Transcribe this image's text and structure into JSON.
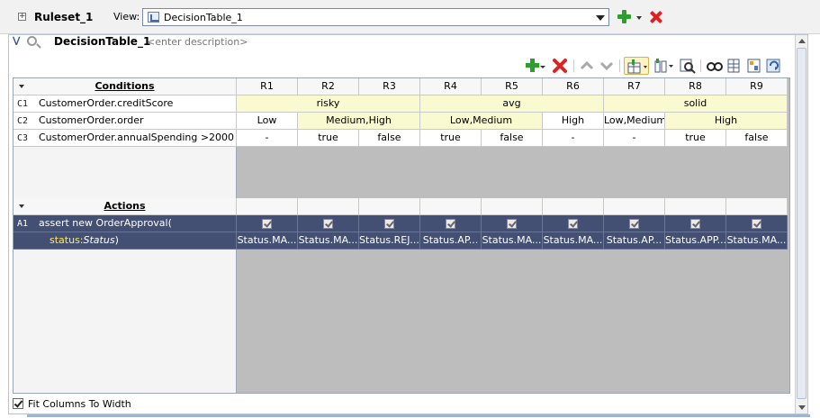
{
  "ruleset": {
    "title": "Ruleset_1",
    "view_label": "View:",
    "view_value": "DecisionTable_1"
  },
  "table": {
    "title": "DecisionTable_1",
    "description": "<enter description>"
  },
  "conditions_header": "Conditions",
  "actions_header": "Actions",
  "columns": [
    "R1",
    "R2",
    "R3",
    "R4",
    "R5",
    "R6",
    "R7",
    "R8",
    "R9"
  ],
  "conditions": [
    {
      "id": "C1",
      "label": "CustomerOrder.creditScore",
      "cells": [
        {
          "text": "risky",
          "span": 3,
          "bg": "#fafad1"
        },
        {
          "text": "avg",
          "span": 3,
          "bg": "#fafad1"
        },
        {
          "text": "solid",
          "span": 3,
          "bg": "#fafad1"
        }
      ]
    },
    {
      "id": "C2",
      "label": "CustomerOrder.order",
      "cells": [
        {
          "text": "Low",
          "span": 1,
          "bg": "#ffffff"
        },
        {
          "text": "Medium,High",
          "span": 2,
          "bg": "#fafad1"
        },
        {
          "text": "Low,Medium",
          "span": 2,
          "bg": "#fafad1"
        },
        {
          "text": "High",
          "span": 1,
          "bg": "#ffffff"
        },
        {
          "text": "Low,Medium",
          "span": 1,
          "bg": "#ffffff"
        },
        {
          "text": "High",
          "span": 2,
          "bg": "#fafad1"
        }
      ]
    },
    {
      "id": "C3",
      "label": "CustomerOrder.annualSpending >2000",
      "cells": [
        {
          "text": "-",
          "span": 1,
          "bg": "#ffffff"
        },
        {
          "text": "true",
          "span": 1,
          "bg": "#ffffff"
        },
        {
          "text": "false",
          "span": 1,
          "bg": "#ffffff"
        },
        {
          "text": "true",
          "span": 1,
          "bg": "#ffffff"
        },
        {
          "text": "false",
          "span": 1,
          "bg": "#ffffff"
        },
        {
          "text": "-",
          "span": 1,
          "bg": "#ffffff"
        },
        {
          "text": "-",
          "span": 1,
          "bg": "#ffffff"
        },
        {
          "text": "true",
          "span": 1,
          "bg": "#ffffff"
        },
        {
          "text": "false",
          "span": 1,
          "bg": "#ffffff"
        }
      ]
    }
  ],
  "action": {
    "id": "A1",
    "label": "assert new OrderApproval(",
    "arg_name": "status:",
    "arg_type": "Status",
    "arg_close": ")",
    "checked": [
      true,
      true,
      true,
      true,
      true,
      true,
      true,
      true,
      true
    ],
    "values": [
      "Status.MA...",
      "Status.MA...",
      "Status.REJ...",
      "Status.AP...",
      "Status.MA...",
      "Status.MA...",
      "Status.AP...",
      "Status.APP...",
      "Status.MA..."
    ]
  },
  "footer": {
    "fit_columns_label": "Fit Columns To Width",
    "fit_columns_checked": true
  },
  "icons": {
    "add": "plus-icon",
    "delete": "delete-x-icon",
    "move_up": "move-up-icon",
    "move_down": "move-down-icon",
    "merge": "merge-cells-icon",
    "split": "split-cells-icon",
    "find": "find-icon",
    "gap": "gap-analysis-icon",
    "conflicts": "conflict-icon",
    "compact": "compact-table-icon",
    "refresh": "refresh-icon"
  },
  "colors": {
    "action_row": "#434f73",
    "condition_highlight": "#fafad1",
    "arg_name": "#ffe86a"
  }
}
